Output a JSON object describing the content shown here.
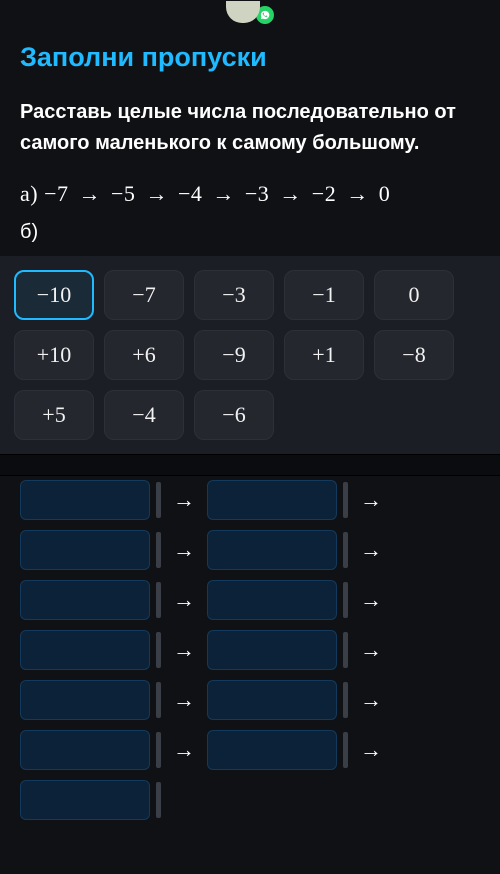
{
  "header": {
    "whatsapp_icon": "wa"
  },
  "title": "Заполни пропуски",
  "instruction": "Расставь целые числа последовательно от самого маленького к самому большому.",
  "part_a": {
    "label": "а)",
    "sequence": [
      "−7",
      "−5",
      "−4",
      "−3",
      "−2",
      "0"
    ]
  },
  "part_b_label": "б)",
  "chips": [
    {
      "label": "−10",
      "selected": true
    },
    {
      "label": "−7",
      "selected": false
    },
    {
      "label": "−3",
      "selected": false
    },
    {
      "label": "−1",
      "selected": false
    },
    {
      "label": "0",
      "selected": false
    },
    {
      "label": "+10",
      "selected": false
    },
    {
      "label": "+6",
      "selected": false
    },
    {
      "label": "−9",
      "selected": false
    },
    {
      "label": "+1",
      "selected": false
    },
    {
      "label": "−8",
      "selected": false
    },
    {
      "label": "+5",
      "selected": false
    },
    {
      "label": "−4",
      "selected": false
    },
    {
      "label": "−6",
      "selected": false
    }
  ],
  "arrow_glyph": "→",
  "slot_rows": 6,
  "final_slot": true
}
